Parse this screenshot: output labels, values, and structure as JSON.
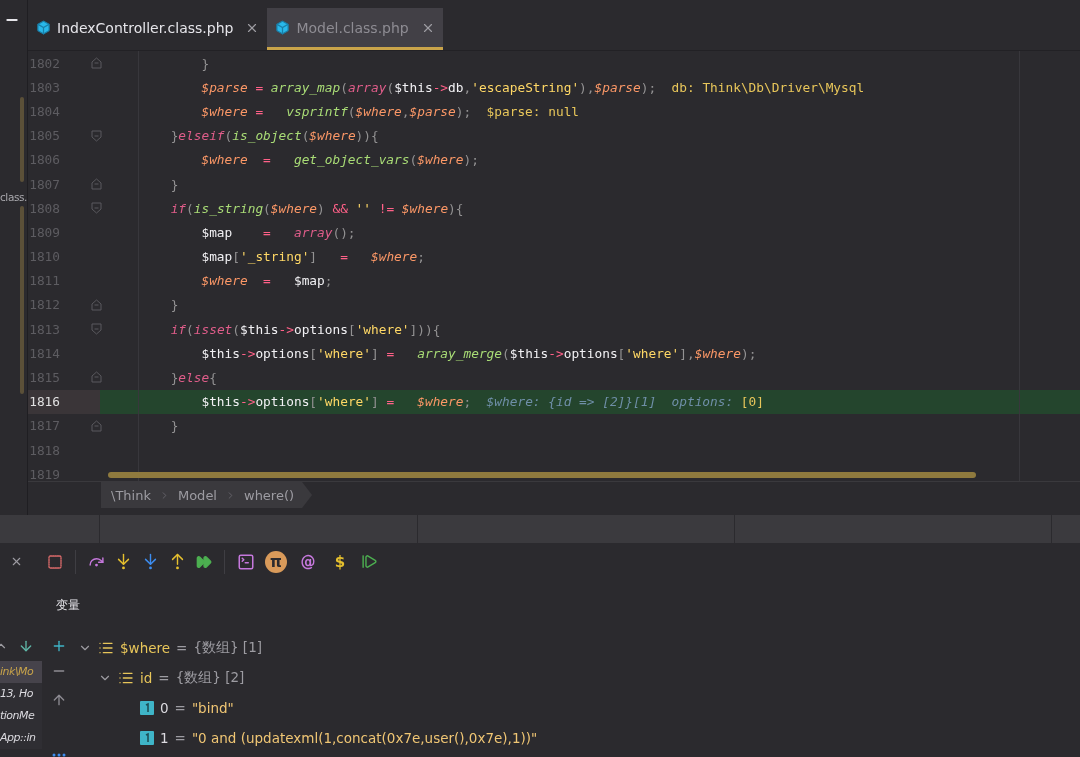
{
  "sidebar": {
    "label": "class."
  },
  "tabs": [
    {
      "label": "IndexController.class.php",
      "selected": false
    },
    {
      "label": "Model.class.php",
      "selected": true
    }
  ],
  "code_lines": [
    {
      "number": "1802",
      "fold_start": false,
      "fold_end": true,
      "current": false,
      "tokens": [
        {
          "kind": "punct",
          "text": "            }"
        }
      ]
    },
    {
      "number": "1803",
      "fold_start": false,
      "fold_end": false,
      "current": false,
      "tokens": [
        {
          "kind": "var",
          "text": "            $parse"
        },
        {
          "kind": "op",
          "text": " = "
        },
        {
          "kind": "func",
          "text": "array_map"
        },
        {
          "kind": "punct",
          "text": "("
        },
        {
          "kind": "keyword",
          "text": "array"
        },
        {
          "kind": "punct",
          "text": "("
        },
        {
          "kind": "plain",
          "text": "$this"
        },
        {
          "kind": "op",
          "text": "->"
        },
        {
          "kind": "plain",
          "text": "db"
        },
        {
          "kind": "punct",
          "text": ","
        },
        {
          "kind": "string",
          "text": "'escapeString'"
        },
        {
          "kind": "punct",
          "text": "),"
        },
        {
          "kind": "var",
          "text": "$parse"
        },
        {
          "kind": "punct",
          "text": ");  "
        },
        {
          "kind": "hint",
          "text": "db: Think\\Db\\Driver\\Mysql"
        }
      ]
    },
    {
      "number": "1804",
      "fold_start": false,
      "fold_end": false,
      "current": false,
      "tokens": [
        {
          "kind": "var",
          "text": "            $where"
        },
        {
          "kind": "op",
          "text": " =   "
        },
        {
          "kind": "func",
          "text": "vsprintf"
        },
        {
          "kind": "punct",
          "text": "("
        },
        {
          "kind": "var",
          "text": "$where"
        },
        {
          "kind": "punct",
          "text": ","
        },
        {
          "kind": "var",
          "text": "$parse"
        },
        {
          "kind": "punct",
          "text": ");  "
        },
        {
          "kind": "hint",
          "text": "$parse: null"
        }
      ]
    },
    {
      "number": "1805",
      "fold_start": true,
      "fold_end": false,
      "current": false,
      "tokens": [
        {
          "kind": "punct",
          "text": "        }"
        },
        {
          "kind": "keyword",
          "text": "elseif"
        },
        {
          "kind": "punct",
          "text": "("
        },
        {
          "kind": "func",
          "text": "is_object"
        },
        {
          "kind": "punct",
          "text": "("
        },
        {
          "kind": "var",
          "text": "$where"
        },
        {
          "kind": "punct",
          "text": ")){"
        }
      ]
    },
    {
      "number": "1806",
      "fold_start": false,
      "fold_end": false,
      "current": false,
      "tokens": [
        {
          "kind": "var",
          "text": "            $where"
        },
        {
          "kind": "op",
          "text": "  =   "
        },
        {
          "kind": "func",
          "text": "get_object_vars"
        },
        {
          "kind": "punct",
          "text": "("
        },
        {
          "kind": "var",
          "text": "$where"
        },
        {
          "kind": "punct",
          "text": ");"
        }
      ]
    },
    {
      "number": "1807",
      "fold_start": false,
      "fold_end": true,
      "current": false,
      "tokens": [
        {
          "kind": "punct",
          "text": "        }"
        }
      ]
    },
    {
      "number": "1808",
      "fold_start": true,
      "fold_end": false,
      "current": false,
      "tokens": [
        {
          "kind": "keyword",
          "text": "        if"
        },
        {
          "kind": "punct",
          "text": "("
        },
        {
          "kind": "func",
          "text": "is_string"
        },
        {
          "kind": "punct",
          "text": "("
        },
        {
          "kind": "var",
          "text": "$where"
        },
        {
          "kind": "punct",
          "text": ") "
        },
        {
          "kind": "op",
          "text": "&&"
        },
        {
          "kind": "string",
          "text": " '' "
        },
        {
          "kind": "op",
          "text": "!="
        },
        {
          "kind": "var",
          "text": " $where"
        },
        {
          "kind": "punct",
          "text": "){"
        }
      ]
    },
    {
      "number": "1809",
      "fold_start": false,
      "fold_end": false,
      "current": false,
      "tokens": [
        {
          "kind": "plain",
          "text": "            $map"
        },
        {
          "kind": "op",
          "text": "    =   "
        },
        {
          "kind": "keyword",
          "text": "array"
        },
        {
          "kind": "punct",
          "text": "();"
        }
      ]
    },
    {
      "number": "1810",
      "fold_start": false,
      "fold_end": false,
      "current": false,
      "tokens": [
        {
          "kind": "plain",
          "text": "            $map"
        },
        {
          "kind": "punct",
          "text": "["
        },
        {
          "kind": "string",
          "text": "'_string'"
        },
        {
          "kind": "punct",
          "text": "]"
        },
        {
          "kind": "op",
          "text": "   =   "
        },
        {
          "kind": "var",
          "text": "$where"
        },
        {
          "kind": "punct",
          "text": ";"
        }
      ]
    },
    {
      "number": "1811",
      "fold_start": false,
      "fold_end": false,
      "current": false,
      "tokens": [
        {
          "kind": "var",
          "text": "            $where"
        },
        {
          "kind": "op",
          "text": "  =   "
        },
        {
          "kind": "plain",
          "text": "$map"
        },
        {
          "kind": "punct",
          "text": ";"
        }
      ]
    },
    {
      "number": "1812",
      "fold_start": false,
      "fold_end": true,
      "current": false,
      "tokens": [
        {
          "kind": "punct",
          "text": "        }"
        }
      ]
    },
    {
      "number": "1813",
      "fold_start": true,
      "fold_end": false,
      "current": false,
      "tokens": [
        {
          "kind": "keyword",
          "text": "        if"
        },
        {
          "kind": "punct",
          "text": "("
        },
        {
          "kind": "keyword",
          "text": "isset"
        },
        {
          "kind": "punct",
          "text": "("
        },
        {
          "kind": "plain",
          "text": "$this"
        },
        {
          "kind": "op",
          "text": "->"
        },
        {
          "kind": "plain",
          "text": "options"
        },
        {
          "kind": "punct",
          "text": "["
        },
        {
          "kind": "string",
          "text": "'where'"
        },
        {
          "kind": "punct",
          "text": "])){"
        }
      ]
    },
    {
      "number": "1814",
      "fold_start": false,
      "fold_end": false,
      "current": false,
      "tokens": [
        {
          "kind": "plain",
          "text": "            $this"
        },
        {
          "kind": "op",
          "text": "->"
        },
        {
          "kind": "plain",
          "text": "options"
        },
        {
          "kind": "punct",
          "text": "["
        },
        {
          "kind": "string",
          "text": "'where'"
        },
        {
          "kind": "punct",
          "text": "]"
        },
        {
          "kind": "op",
          "text": " =   "
        },
        {
          "kind": "func",
          "text": "array_merge"
        },
        {
          "kind": "punct",
          "text": "("
        },
        {
          "kind": "plain",
          "text": "$this"
        },
        {
          "kind": "op",
          "text": "->"
        },
        {
          "kind": "plain",
          "text": "options"
        },
        {
          "kind": "punct",
          "text": "["
        },
        {
          "kind": "string",
          "text": "'where'"
        },
        {
          "kind": "punct",
          "text": "],"
        },
        {
          "kind": "var",
          "text": "$where"
        },
        {
          "kind": "punct",
          "text": ");"
        }
      ]
    },
    {
      "number": "1815",
      "fold_start": false,
      "fold_end": true,
      "current": false,
      "tokens": [
        {
          "kind": "punct",
          "text": "        }"
        },
        {
          "kind": "keyword",
          "text": "else"
        },
        {
          "kind": "punct",
          "text": "{"
        }
      ]
    },
    {
      "number": "1816",
      "fold_start": false,
      "fold_end": false,
      "current": true,
      "tokens": [
        {
          "kind": "plain",
          "text": "            $this"
        },
        {
          "kind": "op",
          "text": "->"
        },
        {
          "kind": "plain",
          "text": "options"
        },
        {
          "kind": "punct",
          "text": "["
        },
        {
          "kind": "string",
          "text": "'where'"
        },
        {
          "kind": "punct",
          "text": "]"
        },
        {
          "kind": "op",
          "text": " =   "
        },
        {
          "kind": "var",
          "text": "$where"
        },
        {
          "kind": "punct",
          "text": ";  "
        },
        {
          "kind": "hint-var",
          "text": "$where: {id => [2]}[1]  options: "
        },
        {
          "kind": "hint",
          "text": "[0]"
        }
      ]
    },
    {
      "number": "1817",
      "fold_start": false,
      "fold_end": true,
      "current": false,
      "tokens": [
        {
          "kind": "punct",
          "text": "        }"
        }
      ]
    },
    {
      "number": "1818",
      "fold_start": false,
      "fold_end": false,
      "current": false
    },
    {
      "number": "1819",
      "fold_start": false,
      "fold_end": false,
      "current": false
    }
  ],
  "breadcrumb": [
    "\\Think",
    "Model",
    "where()"
  ],
  "toolbar_symbols": [
    "π",
    "@",
    "$"
  ],
  "variables": {
    "title": "变量",
    "assign": "=",
    "tree": [
      {
        "kind": "array",
        "name": "$where",
        "type": "{数组}",
        "size": "[1]",
        "expanded": true,
        "children": [
          {
            "kind": "array",
            "name": "id",
            "type": "{数组}",
            "size": "[2]",
            "expanded": true,
            "children": [
              {
                "kind": "scalar",
                "name": "0",
                "value": "\"bind\""
              },
              {
                "kind": "scalar",
                "name": "1",
                "value": "\"0 and (updatexml(1,concat(0x7e,user(),0x7e),1))\""
              }
            ]
          }
        ]
      }
    ]
  },
  "frames": [
    {
      "text": "ink\\Mo",
      "selected": true
    },
    {
      "text": "13, Ho",
      "selected": false
    },
    {
      "text": "tionMe",
      "selected": false
    },
    {
      "text": "App::in",
      "selected": false
    }
  ]
}
